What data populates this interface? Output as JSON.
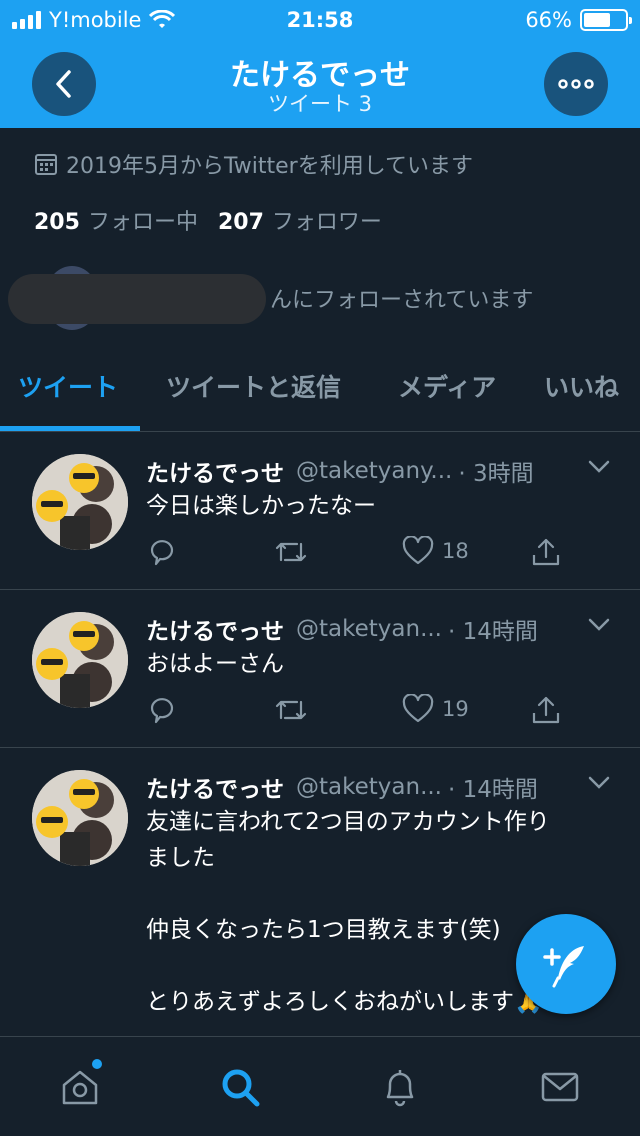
{
  "status_bar": {
    "carrier": "Y!mobile",
    "time": "21:58",
    "battery": "66%",
    "battery_level": 0.66
  },
  "header": {
    "name": "たけるでっせ",
    "tweet_count": "ツイート 3",
    "back_icon": "chevron-left-icon",
    "more_icon": "ellipsis-icon"
  },
  "profile": {
    "joined": "2019年5月からTwitterを利用しています",
    "following_count": "205",
    "following_label": "フォロー中",
    "followers_count": "207",
    "followers_label": "フォロワー",
    "followed_by_text": "んにフォローされています"
  },
  "tabs": [
    {
      "label": "ツイート",
      "active": true
    },
    {
      "label": "ツイートと返信",
      "active": false
    },
    {
      "label": "メディア",
      "active": false
    },
    {
      "label": "いいね",
      "active": false
    }
  ],
  "tweets": [
    {
      "name": "たけるでっせ",
      "handle": "@taketyany...",
      "time": "· 3時間",
      "text": "今日は楽しかったなー",
      "likes": "18"
    },
    {
      "name": "たけるでっせ",
      "handle": "@taketyan...",
      "time": "· 14時間",
      "text": "おはよーさん",
      "likes": "19"
    },
    {
      "name": "たけるでっせ",
      "handle": "@taketyan...",
      "time": "· 14時間",
      "text": "友達に言われて2つ目のアカウント作り\nました\n\n仲良くなったら1つ目教えます(笑)\n\nとりあえずよろしくおねがいします🙏",
      "likes": ""
    }
  ],
  "colors": {
    "accent": "#1da1f2",
    "background": "#15202b",
    "secondary_text": "#8899a6",
    "divider": "#38444d"
  },
  "bottom_nav": [
    "home-icon",
    "search-icon",
    "notifications-icon",
    "messages-icon"
  ]
}
